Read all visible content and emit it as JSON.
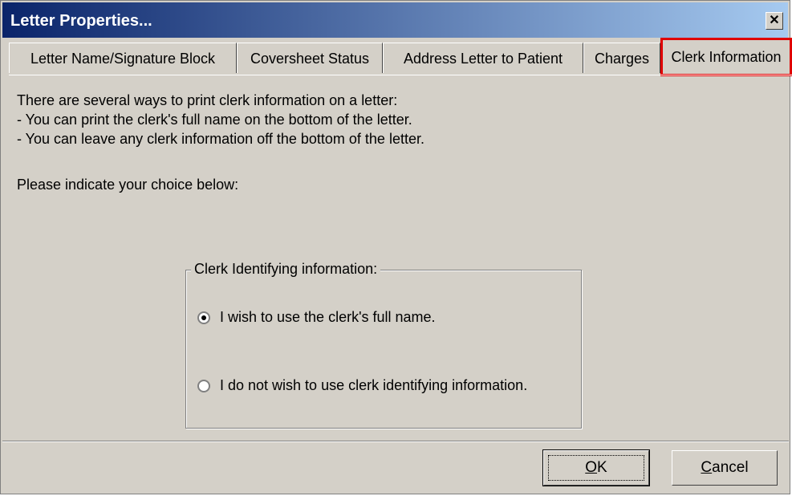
{
  "window": {
    "title": "Letter Properties...",
    "close_glyph": "✕"
  },
  "tabs": [
    {
      "label": "Letter Name/Signature  Block"
    },
    {
      "label": "Coversheet Status"
    },
    {
      "label": "Address Letter to Patient"
    },
    {
      "label": "Charges"
    },
    {
      "label": "Clerk Information",
      "active": true
    }
  ],
  "content": {
    "line1": "There are several ways to print clerk information on a letter:",
    "line2": "- You can print the clerk's full name on the bottom of the letter.",
    "line3": "- You can leave any clerk information off the bottom of the letter.",
    "prompt": "Please indicate your choice below:"
  },
  "group": {
    "legend": "Clerk Identifying information:",
    "options": [
      {
        "label": "I wish to use the clerk's full name.",
        "checked": true
      },
      {
        "label": "I do not wish to use clerk identifying information.",
        "checked": false
      }
    ]
  },
  "buttons": {
    "ok_accel": "O",
    "ok_rest": "K",
    "cancel_accel": "C",
    "cancel_rest": "ancel"
  },
  "colors": {
    "title_start": "#0a246a",
    "title_end": "#a6caf0",
    "face": "#d4d0c8",
    "active_tab_highlight": "#e00000"
  }
}
